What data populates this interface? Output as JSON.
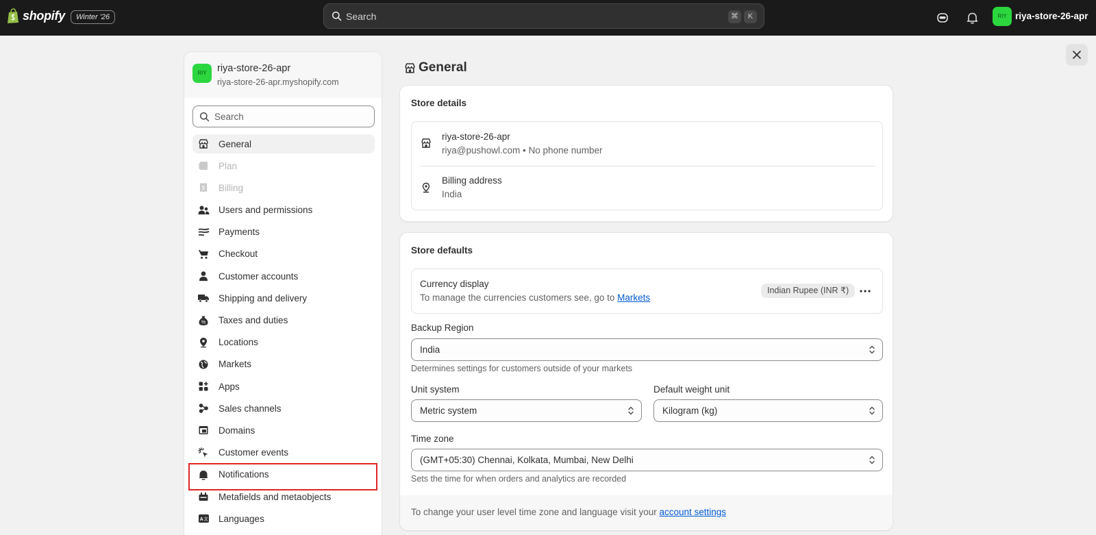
{
  "topbar": {
    "brand": "shopify",
    "edition_badge": "Winter '26",
    "search_placeholder": "Search",
    "shortcut_keys": [
      "⌘",
      "K"
    ],
    "avatar_initials": "RIY",
    "store_name": "riya-store-26-apr"
  },
  "sidebar": {
    "store_name": "riya-store-26-apr",
    "store_domain": "riya-store-26-apr.myshopify.com",
    "avatar_initials": "RIY",
    "search_placeholder": "Search",
    "items": [
      {
        "label": "General",
        "icon": "store-icon",
        "state": "active"
      },
      {
        "label": "Plan",
        "icon": "plan-icon",
        "state": "disabled"
      },
      {
        "label": "Billing",
        "icon": "billing-icon",
        "state": "disabled"
      },
      {
        "label": "Users and permissions",
        "icon": "users-icon",
        "state": "normal"
      },
      {
        "label": "Payments",
        "icon": "payments-icon",
        "state": "normal"
      },
      {
        "label": "Checkout",
        "icon": "cart-icon",
        "state": "normal"
      },
      {
        "label": "Customer accounts",
        "icon": "person-icon",
        "state": "normal"
      },
      {
        "label": "Shipping and delivery",
        "icon": "truck-icon",
        "state": "normal"
      },
      {
        "label": "Taxes and duties",
        "icon": "tax-icon",
        "state": "normal"
      },
      {
        "label": "Locations",
        "icon": "location-icon",
        "state": "normal"
      },
      {
        "label": "Markets",
        "icon": "globe-icon",
        "state": "normal"
      },
      {
        "label": "Apps",
        "icon": "apps-icon",
        "state": "normal"
      },
      {
        "label": "Sales channels",
        "icon": "sales-channels-icon",
        "state": "normal"
      },
      {
        "label": "Domains",
        "icon": "domains-icon",
        "state": "normal"
      },
      {
        "label": "Customer events",
        "icon": "cursor-click-icon",
        "state": "normal"
      },
      {
        "label": "Notifications",
        "icon": "bell-icon",
        "state": "highlighted"
      },
      {
        "label": "Metafields and metaobjects",
        "icon": "metafields-icon",
        "state": "normal"
      },
      {
        "label": "Languages",
        "icon": "languages-icon",
        "state": "normal"
      }
    ]
  },
  "page": {
    "title": "General"
  },
  "store_details": {
    "title": "Store details",
    "store_name": "riya-store-26-apr",
    "contact": "riya@pushowl.com • No phone number",
    "billing_label": "Billing address",
    "billing_value": "India"
  },
  "store_defaults": {
    "title": "Store defaults",
    "currency_label": "Currency display",
    "currency_help_prefix": "To manage the currencies customers see, go to",
    "currency_help_link": "Markets",
    "currency_value": "Indian Rupee (INR ₹)",
    "backup_region_label": "Backup Region",
    "backup_region_value": "India",
    "backup_region_help": "Determines settings for customers outside of your markets",
    "unit_system_label": "Unit system",
    "unit_system_value": "Metric system",
    "weight_unit_label": "Default weight unit",
    "weight_unit_value": "Kilogram (kg)",
    "timezone_label": "Time zone",
    "timezone_value": "(GMT+05:30) Chennai, Kolkata, Mumbai, New Delhi",
    "timezone_help": "Sets the time for when orders and analytics are recorded",
    "footer_prefix": "To change your user level time zone and language visit your",
    "footer_link": "account settings"
  }
}
